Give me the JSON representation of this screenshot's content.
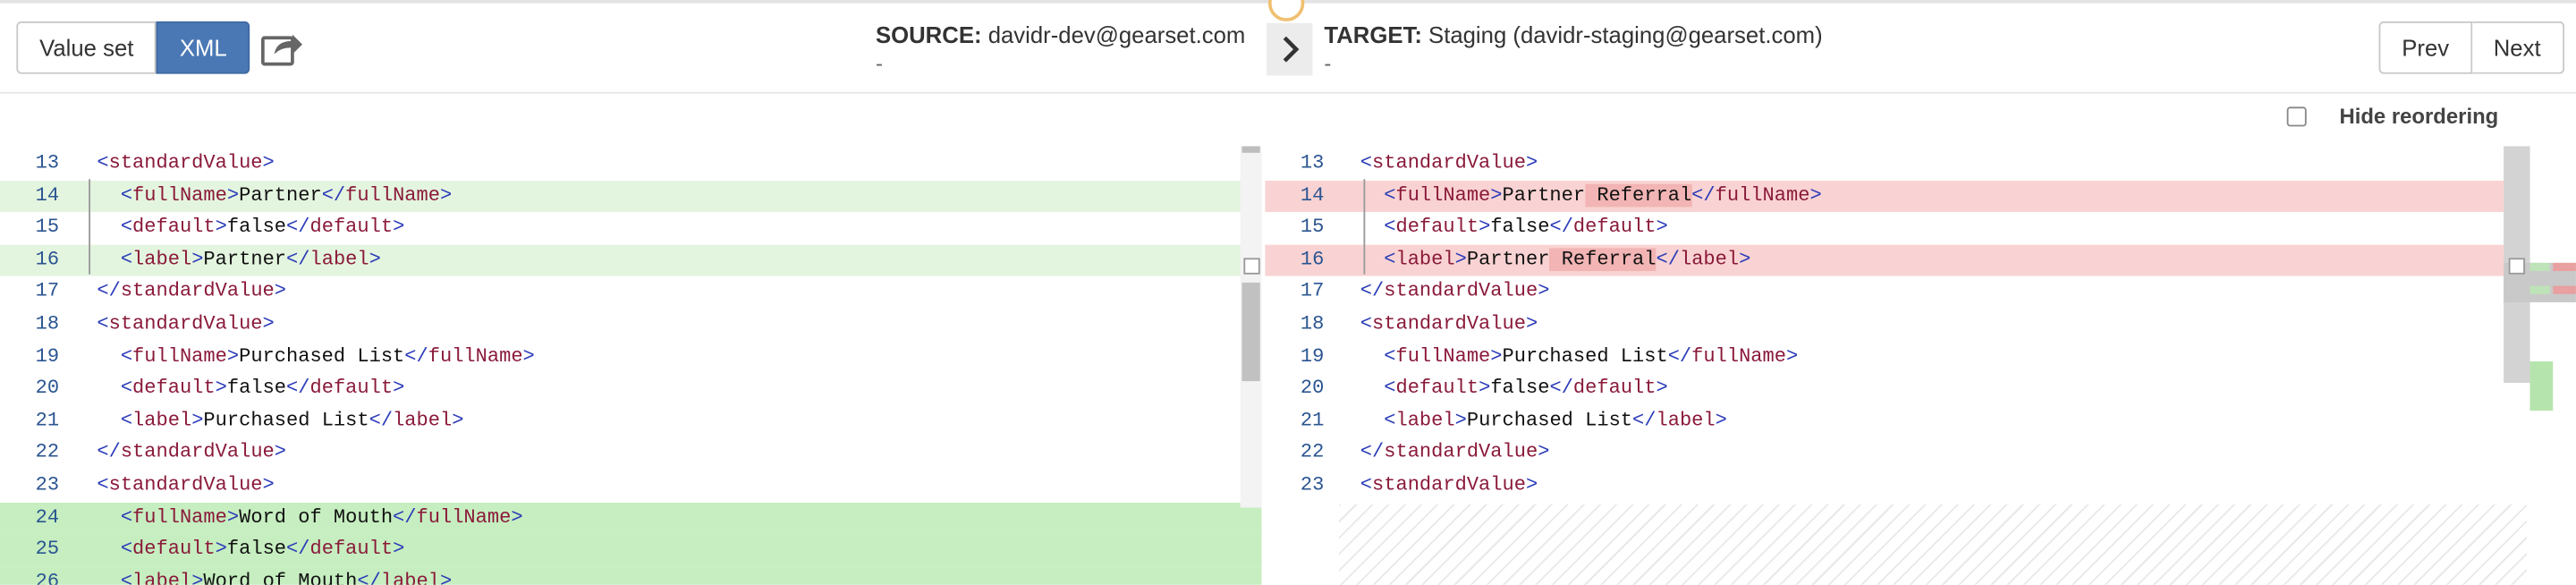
{
  "toolbar": {
    "value_set_label": "Value set",
    "xml_label": "XML",
    "share_icon": "share-icon"
  },
  "source": {
    "prefix": "SOURCE:",
    "value": "davidr-dev@gearset.com",
    "sub": "-"
  },
  "target": {
    "prefix": "TARGET:",
    "value": "Staging (davidr-staging@gearset.com)",
    "sub": "-"
  },
  "nav": {
    "prev_label": "Prev",
    "next_label": "Next"
  },
  "options": {
    "hide_reordering_label": "Hide reordering",
    "hide_reordering_checked": false
  },
  "colors": {
    "accent": "#4a78b5",
    "added_light": "#e4f5df",
    "added_strong": "#c6eec0",
    "removed": "#f9d3d3",
    "removed_highlight": "#f2b4b4"
  },
  "left_lines": [
    {
      "num": "13",
      "indent": "",
      "open": "standardValue",
      "text": "",
      "close": ""
    },
    {
      "num": "14",
      "indent": "  ",
      "open": "fullName",
      "text": "Partner",
      "close": "fullName"
    },
    {
      "num": "15",
      "indent": "  ",
      "open": "default",
      "text": "false",
      "close": "default"
    },
    {
      "num": "16",
      "indent": "  ",
      "open": "label",
      "text": "Partner",
      "close": "label"
    },
    {
      "num": "17",
      "indent": "",
      "open": "",
      "text": "",
      "close": "standardValue"
    },
    {
      "num": "18",
      "indent": "",
      "open": "standardValue",
      "text": "",
      "close": ""
    },
    {
      "num": "19",
      "indent": "  ",
      "open": "fullName",
      "text": "Purchased List",
      "close": "fullName"
    },
    {
      "num": "20",
      "indent": "  ",
      "open": "default",
      "text": "false",
      "close": "default"
    },
    {
      "num": "21",
      "indent": "  ",
      "open": "label",
      "text": "Purchased List",
      "close": "label"
    },
    {
      "num": "22",
      "indent": "",
      "open": "",
      "text": "",
      "close": "standardValue"
    },
    {
      "num": "23",
      "indent": "",
      "open": "standardValue",
      "text": "",
      "close": ""
    },
    {
      "num": "24",
      "indent": "  ",
      "open": "fullName",
      "text": "Word of Mouth",
      "close": "fullName"
    },
    {
      "num": "25",
      "indent": "  ",
      "open": "default",
      "text": "false",
      "close": "default"
    },
    {
      "num": "26",
      "indent": "  ",
      "open": "label",
      "text": "Word of Mouth",
      "close": "label"
    }
  ],
  "right_lines": [
    {
      "num": "13",
      "indent": "",
      "open": "standardValue",
      "text": "",
      "extra": "",
      "close": ""
    },
    {
      "num": "14",
      "indent": "  ",
      "open": "fullName",
      "text": "Partner",
      "extra": " Referral",
      "close": "fullName"
    },
    {
      "num": "15",
      "indent": "  ",
      "open": "default",
      "text": "false",
      "extra": "",
      "close": "default"
    },
    {
      "num": "16",
      "indent": "  ",
      "open": "label",
      "text": "Partner",
      "extra": " Referral",
      "close": "label"
    },
    {
      "num": "17",
      "indent": "",
      "open": "",
      "text": "",
      "extra": "",
      "close": "standardValue"
    },
    {
      "num": "18",
      "indent": "",
      "open": "standardValue",
      "text": "",
      "extra": "",
      "close": ""
    },
    {
      "num": "19",
      "indent": "  ",
      "open": "fullName",
      "text": "Purchased List",
      "extra": "",
      "close": "fullName"
    },
    {
      "num": "20",
      "indent": "  ",
      "open": "default",
      "text": "false",
      "extra": "",
      "close": "default"
    },
    {
      "num": "21",
      "indent": "  ",
      "open": "label",
      "text": "Purchased List",
      "extra": "",
      "close": "label"
    },
    {
      "num": "22",
      "indent": "",
      "open": "",
      "text": "",
      "extra": "",
      "close": "standardValue"
    },
    {
      "num": "23",
      "indent": "",
      "open": "standardValue",
      "text": "",
      "extra": "",
      "close": ""
    }
  ],
  "left_states": [
    "",
    "add-light",
    "",
    "add-light",
    "",
    "",
    "",
    "",
    "",
    "",
    "",
    "add-strong",
    "add-strong",
    "add-strong"
  ],
  "right_states": [
    "",
    "del",
    "",
    "del",
    "",
    "",
    "",
    "",
    "",
    "",
    ""
  ]
}
